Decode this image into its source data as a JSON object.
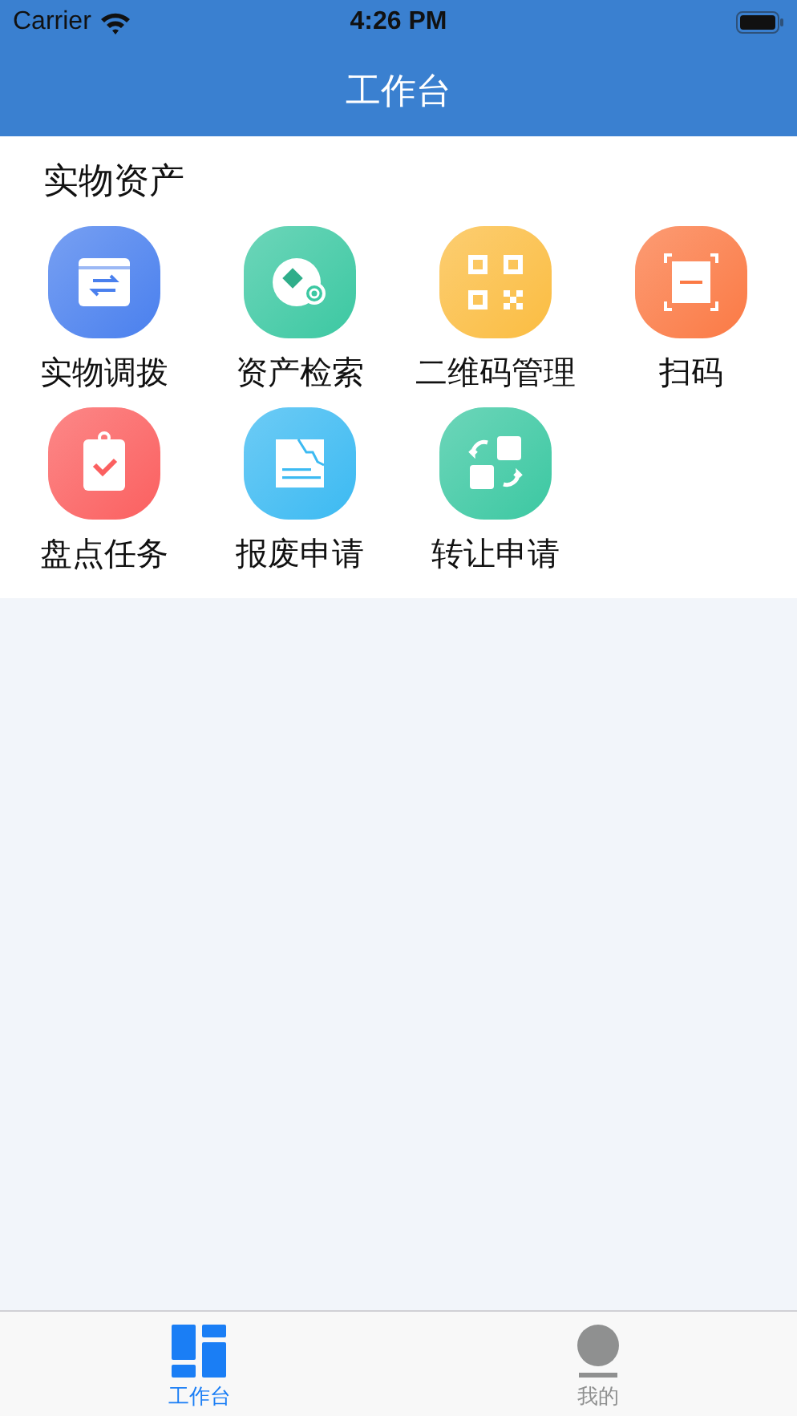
{
  "status_bar": {
    "carrier": "Carrier",
    "time": "4:26 PM"
  },
  "nav_bar": {
    "title": "工作台"
  },
  "section": {
    "title": "实物资产",
    "items": [
      {
        "label": "实物调拨",
        "kind": "transfer",
        "color": "#4a80ee"
      },
      {
        "label": "资产检索",
        "kind": "search",
        "color": "#3cc8a2"
      },
      {
        "label": "二维码管理",
        "kind": "qrcode",
        "color": "#fbbd42"
      },
      {
        "label": "扫码",
        "kind": "scan",
        "color": "#fb7a45"
      },
      {
        "label": "盘点任务",
        "kind": "checklist",
        "color": "#fb6060"
      },
      {
        "label": "报废申请",
        "kind": "document",
        "color": "#3cbaf2"
      },
      {
        "label": "转让申请",
        "kind": "exchange",
        "color": "#3cc8a2"
      }
    ]
  },
  "tab_bar": {
    "tabs": [
      {
        "label": "工作台",
        "kind": "dashboard",
        "selected": true
      },
      {
        "label": "我的",
        "kind": "profile",
        "selected": false
      }
    ]
  }
}
